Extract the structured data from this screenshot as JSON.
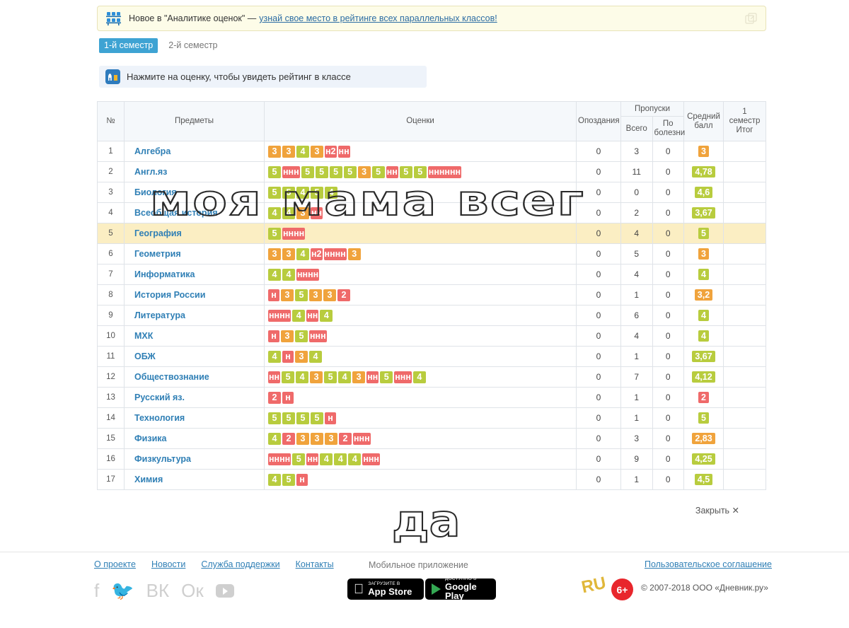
{
  "notice": {
    "icon": "seats-icon",
    "text": "Новое в \"Аналитике оценок\" —",
    "link": "узнай свое место в рейтинге всех параллельных классов!",
    "close_icon": "window-restore-icon"
  },
  "tabs": [
    {
      "label": "1-й семестр",
      "active": true
    },
    {
      "label": "2-й семестр",
      "active": false
    }
  ],
  "hint": {
    "icon": "analytics-icon",
    "text": "Нажмите на оценку, чтобы увидеть рейтинг в классе"
  },
  "table": {
    "headers": {
      "num": "№",
      "subjects": "Предметы",
      "marks": "Оценки",
      "late": "Опоздания",
      "absences_group": "Пропуски",
      "absences_total": "Всего",
      "absences_illness": "По болезни",
      "average": "Средний балл",
      "total": "1 семестр Итог",
      "total_line1": "1",
      "total_line2": "семестр",
      "total_line3": "Итог"
    },
    "rows": [
      {
        "num": "1",
        "subject": "Алгебра",
        "highlight": false,
        "marks": [
          {
            "v": "3",
            "t": "m3"
          },
          {
            "v": "3",
            "t": "m3"
          },
          {
            "v": "4",
            "t": "m4"
          },
          {
            "v": "3",
            "t": "m3"
          },
          {
            "v": "н2",
            "t": "mn grp"
          },
          {
            "v": "нн",
            "t": "mn grp"
          }
        ],
        "late": "0",
        "absent_total": "3",
        "absent_illness": "0",
        "average": "3",
        "average_color": "avg-orange",
        "total": ""
      },
      {
        "num": "2",
        "subject": "Англ.яз",
        "highlight": false,
        "marks": [
          {
            "v": "5",
            "t": "m5"
          },
          {
            "v": "ннн",
            "t": "mn grp"
          },
          {
            "v": "5",
            "t": "m5"
          },
          {
            "v": "5",
            "t": "m5"
          },
          {
            "v": "5",
            "t": "m5"
          },
          {
            "v": "5",
            "t": "m5"
          },
          {
            "v": "3",
            "t": "m3"
          },
          {
            "v": "5",
            "t": "m5"
          },
          {
            "v": "нн",
            "t": "mn grp"
          },
          {
            "v": "5",
            "t": "m5"
          },
          {
            "v": "5",
            "t": "m5"
          },
          {
            "v": "нннннн",
            "t": "mn grp"
          }
        ],
        "late": "0",
        "absent_total": "11",
        "absent_illness": "0",
        "average": "4,78",
        "average_color": "avg-green",
        "total": ""
      },
      {
        "num": "3",
        "subject": "Биология",
        "highlight": false,
        "marks": [
          {
            "v": "5",
            "t": "m5"
          },
          {
            "v": "5",
            "t": "m5"
          },
          {
            "v": "4",
            "t": "m4"
          },
          {
            "v": "5",
            "t": "m5"
          },
          {
            "v": "4",
            "t": "m4"
          }
        ],
        "late": "0",
        "absent_total": "0",
        "absent_illness": "0",
        "average": "4,6",
        "average_color": "avg-green",
        "total": ""
      },
      {
        "num": "4",
        "subject": "Всеобщая история",
        "highlight": false,
        "marks": [
          {
            "v": "4",
            "t": "m4"
          },
          {
            "v": "4",
            "t": "m4"
          },
          {
            "v": "3",
            "t": "m3"
          },
          {
            "v": "нн",
            "t": "mn grp"
          }
        ],
        "late": "0",
        "absent_total": "2",
        "absent_illness": "0",
        "average": "3,67",
        "average_color": "avg-green",
        "total": ""
      },
      {
        "num": "5",
        "subject": "География",
        "highlight": true,
        "marks": [
          {
            "v": "5",
            "t": "m5"
          },
          {
            "v": "нннн",
            "t": "mn grp"
          }
        ],
        "late": "0",
        "absent_total": "4",
        "absent_illness": "0",
        "average": "5",
        "average_color": "avg-green",
        "total": ""
      },
      {
        "num": "6",
        "subject": "Геометрия",
        "highlight": false,
        "marks": [
          {
            "v": "3",
            "t": "m3"
          },
          {
            "v": "3",
            "t": "m3"
          },
          {
            "v": "4",
            "t": "m4"
          },
          {
            "v": "н2",
            "t": "mn grp"
          },
          {
            "v": "нннн",
            "t": "mn grp"
          },
          {
            "v": "3",
            "t": "m3"
          }
        ],
        "late": "0",
        "absent_total": "5",
        "absent_illness": "0",
        "average": "3",
        "average_color": "avg-orange",
        "total": ""
      },
      {
        "num": "7",
        "subject": "Информатика",
        "highlight": false,
        "marks": [
          {
            "v": "4",
            "t": "m4"
          },
          {
            "v": "4",
            "t": "m4"
          },
          {
            "v": "нннн",
            "t": "mn grp"
          }
        ],
        "late": "0",
        "absent_total": "4",
        "absent_illness": "0",
        "average": "4",
        "average_color": "avg-green",
        "total": ""
      },
      {
        "num": "8",
        "subject": "История России",
        "highlight": false,
        "marks": [
          {
            "v": "н",
            "t": "mn grp"
          },
          {
            "v": "3",
            "t": "m3"
          },
          {
            "v": "5",
            "t": "m5"
          },
          {
            "v": "3",
            "t": "m3"
          },
          {
            "v": "3",
            "t": "m3"
          },
          {
            "v": "2",
            "t": "m2"
          }
        ],
        "late": "0",
        "absent_total": "1",
        "absent_illness": "0",
        "average": "3,2",
        "average_color": "avg-orange",
        "total": ""
      },
      {
        "num": "9",
        "subject": "Литература",
        "highlight": false,
        "marks": [
          {
            "v": "нннн",
            "t": "mn grp"
          },
          {
            "v": "4",
            "t": "m4"
          },
          {
            "v": "нн",
            "t": "mn grp"
          },
          {
            "v": "4",
            "t": "m4"
          }
        ],
        "late": "0",
        "absent_total": "6",
        "absent_illness": "0",
        "average": "4",
        "average_color": "avg-green",
        "total": ""
      },
      {
        "num": "10",
        "subject": "МХК",
        "highlight": false,
        "marks": [
          {
            "v": "н",
            "t": "mn grp"
          },
          {
            "v": "3",
            "t": "m3"
          },
          {
            "v": "5",
            "t": "m5"
          },
          {
            "v": "ннн",
            "t": "mn grp"
          }
        ],
        "late": "0",
        "absent_total": "4",
        "absent_illness": "0",
        "average": "4",
        "average_color": "avg-green",
        "total": ""
      },
      {
        "num": "11",
        "subject": "ОБЖ",
        "highlight": false,
        "marks": [
          {
            "v": "4",
            "t": "m4"
          },
          {
            "v": "н",
            "t": "mn grp"
          },
          {
            "v": "3",
            "t": "m3"
          },
          {
            "v": "4",
            "t": "m4"
          }
        ],
        "late": "0",
        "absent_total": "1",
        "absent_illness": "0",
        "average": "3,67",
        "average_color": "avg-green",
        "total": ""
      },
      {
        "num": "12",
        "subject": "Обществознание",
        "highlight": false,
        "marks": [
          {
            "v": "нн",
            "t": "mn grp"
          },
          {
            "v": "5",
            "t": "m5"
          },
          {
            "v": "4",
            "t": "m4"
          },
          {
            "v": "3",
            "t": "m3"
          },
          {
            "v": "5",
            "t": "m5"
          },
          {
            "v": "4",
            "t": "m4"
          },
          {
            "v": "3",
            "t": "m3"
          },
          {
            "v": "нн",
            "t": "mn grp"
          },
          {
            "v": "5",
            "t": "m5"
          },
          {
            "v": "ннн",
            "t": "mn grp"
          },
          {
            "v": "4",
            "t": "m4"
          }
        ],
        "late": "0",
        "absent_total": "7",
        "absent_illness": "0",
        "average": "4,12",
        "average_color": "avg-green",
        "total": ""
      },
      {
        "num": "13",
        "subject": "Русский яз.",
        "highlight": false,
        "marks": [
          {
            "v": "2",
            "t": "m2"
          },
          {
            "v": "н",
            "t": "mn grp"
          }
        ],
        "late": "0",
        "absent_total": "1",
        "absent_illness": "0",
        "average": "2",
        "average_color": "avg-red",
        "total": ""
      },
      {
        "num": "14",
        "subject": "Технология",
        "highlight": false,
        "marks": [
          {
            "v": "5",
            "t": "m5"
          },
          {
            "v": "5",
            "t": "m5"
          },
          {
            "v": "5",
            "t": "m5"
          },
          {
            "v": "5",
            "t": "m5"
          },
          {
            "v": "н",
            "t": "mn grp"
          }
        ],
        "late": "0",
        "absent_total": "1",
        "absent_illness": "0",
        "average": "5",
        "average_color": "avg-green",
        "total": ""
      },
      {
        "num": "15",
        "subject": "Физика",
        "highlight": false,
        "marks": [
          {
            "v": "4",
            "t": "m4"
          },
          {
            "v": "2",
            "t": "m2"
          },
          {
            "v": "3",
            "t": "m3"
          },
          {
            "v": "3",
            "t": "m3"
          },
          {
            "v": "3",
            "t": "m3"
          },
          {
            "v": "2",
            "t": "m2"
          },
          {
            "v": "ннн",
            "t": "mn grp"
          }
        ],
        "late": "0",
        "absent_total": "3",
        "absent_illness": "0",
        "average": "2,83",
        "average_color": "avg-orange",
        "total": ""
      },
      {
        "num": "16",
        "subject": "Физкультура",
        "highlight": false,
        "marks": [
          {
            "v": "нннн",
            "t": "mn grp"
          },
          {
            "v": "5",
            "t": "m5"
          },
          {
            "v": "нн",
            "t": "mn grp"
          },
          {
            "v": "4",
            "t": "m4"
          },
          {
            "v": "4",
            "t": "m4"
          },
          {
            "v": "4",
            "t": "m4"
          },
          {
            "v": "ннн",
            "t": "mn grp"
          }
        ],
        "late": "0",
        "absent_total": "9",
        "absent_illness": "0",
        "average": "4,25",
        "average_color": "avg-green",
        "total": ""
      },
      {
        "num": "17",
        "subject": "Химия",
        "highlight": false,
        "marks": [
          {
            "v": "4",
            "t": "m4"
          },
          {
            "v": "5",
            "t": "m5"
          },
          {
            "v": "н",
            "t": "mn grp"
          }
        ],
        "late": "0",
        "absent_total": "1",
        "absent_illness": "0",
        "average": "4,5",
        "average_color": "avg-green",
        "total": ""
      }
    ]
  },
  "watermark": {
    "line1": "моя мама всег",
    "line2": "да"
  },
  "close_label": "Закрыть ✕",
  "footer": {
    "links": [
      {
        "label": "О проекте"
      },
      {
        "label": "Новости"
      },
      {
        "label": "Служба поддержки"
      },
      {
        "label": "Контакты"
      }
    ],
    "agreement": "Пользовательское соглашение",
    "mobile_title": "Мобильное приложение",
    "appstore": {
      "small": "Загрузите в",
      "big": "App Store",
      "icon": "apple-icon"
    },
    "googleplay": {
      "small": "Доступно в",
      "big": "Google Play",
      "icon": "play-triangle-icon"
    },
    "socials": [
      "facebook-icon",
      "twitter-icon",
      "vk-icon",
      "odnoklassniki-icon",
      "youtube-icon"
    ],
    "award": "RU",
    "age": "6+",
    "copyright": "© 2007-2018 ООО «Дневник.ру»"
  },
  "colors": {
    "grade_green": "#b8cc3e",
    "grade_orange": "#f0a33c",
    "grade_red": "#ef6a6a",
    "tab_active": "#3ea3d3",
    "link": "#2f7fb5",
    "row_highlight": "#fbeec3"
  }
}
